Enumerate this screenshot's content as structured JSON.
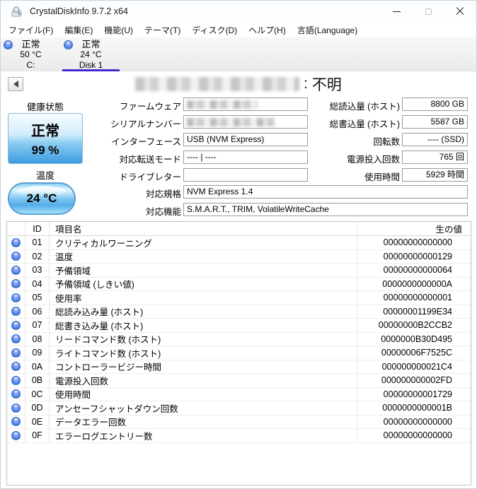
{
  "window": {
    "title": "CrystalDiskInfo 9.7.2 x64"
  },
  "menu": {
    "items": [
      "ファイル(F)",
      "編集(E)",
      "機能(U)",
      "テーマ(T)",
      "ディスク(D)",
      "ヘルプ(H)",
      "言語(Language)"
    ]
  },
  "tabs": [
    {
      "status": "正常",
      "temp": "50 °C",
      "name": "C:",
      "selected": false
    },
    {
      "status": "正常",
      "temp": "24 °C",
      "name": "Disk 1",
      "selected": true
    }
  ],
  "disk": {
    "separator": " : ",
    "model_status": "不明",
    "health_label": "健康状態",
    "health_status": "正常",
    "health_percent": "99 %",
    "temp_label": "温度",
    "temp_value": "24 °C",
    "fields_center": [
      {
        "label": "ファームウェア",
        "value": "",
        "redacted": true
      },
      {
        "label": "シリアルナンバー",
        "value": "",
        "redacted": true
      },
      {
        "label": "インターフェース",
        "value": "USB (NVM Express)"
      },
      {
        "label": "対応転送モード",
        "value": "---- | ----"
      },
      {
        "label": "ドライブレター",
        "value": ""
      }
    ],
    "fields_wide": [
      {
        "label": "対応規格",
        "value": "NVM Express 1.4"
      },
      {
        "label": "対応機能",
        "value": "S.M.A.R.T., TRIM, VolatileWriteCache"
      }
    ],
    "fields_right": [
      {
        "label": "総読込量 (ホスト)",
        "value": "8800 GB"
      },
      {
        "label": "総書込量 (ホスト)",
        "value": "5587 GB"
      },
      {
        "label": "回転数",
        "value": "---- (SSD)"
      },
      {
        "label": "電源投入回数",
        "value": "765 回"
      },
      {
        "label": "使用時間",
        "value": "5929 時間"
      }
    ]
  },
  "smart": {
    "headers": {
      "id": "ID",
      "name": "項目名",
      "raw": "生の値"
    },
    "rows": [
      {
        "id": "01",
        "name": "クリティカルワーニング",
        "raw": "00000000000000"
      },
      {
        "id": "02",
        "name": "温度",
        "raw": "00000000000129"
      },
      {
        "id": "03",
        "name": "予備領域",
        "raw": "00000000000064"
      },
      {
        "id": "04",
        "name": "予備領域 (しきい値)",
        "raw": "0000000000000A"
      },
      {
        "id": "05",
        "name": "使用率",
        "raw": "00000000000001"
      },
      {
        "id": "06",
        "name": "総読み込み量 (ホスト)",
        "raw": "00000001199E34"
      },
      {
        "id": "07",
        "name": "総書き込み量 (ホスト)",
        "raw": "00000000B2CCB2"
      },
      {
        "id": "08",
        "name": "リードコマンド数 (ホスト)",
        "raw": "0000000B30D495"
      },
      {
        "id": "09",
        "name": "ライトコマンド数 (ホスト)",
        "raw": "00000006F7525C"
      },
      {
        "id": "0A",
        "name": "コントローラービジー時間",
        "raw": "000000000021C4"
      },
      {
        "id": "0B",
        "name": "電源投入回数",
        "raw": "000000000002FD"
      },
      {
        "id": "0C",
        "name": "使用時間",
        "raw": "00000000001729"
      },
      {
        "id": "0D",
        "name": "アンセーフシャットダウン回数",
        "raw": "0000000000001B"
      },
      {
        "id": "0E",
        "name": "データエラー回数",
        "raw": "00000000000000"
      },
      {
        "id": "0F",
        "name": "エラーログエントリー数",
        "raw": "00000000000000"
      }
    ]
  },
  "colors": {
    "tab_underline": "#4527cf",
    "health_good_bottom": "#3d9be2",
    "status_orb_blue": "#3f7de6"
  }
}
